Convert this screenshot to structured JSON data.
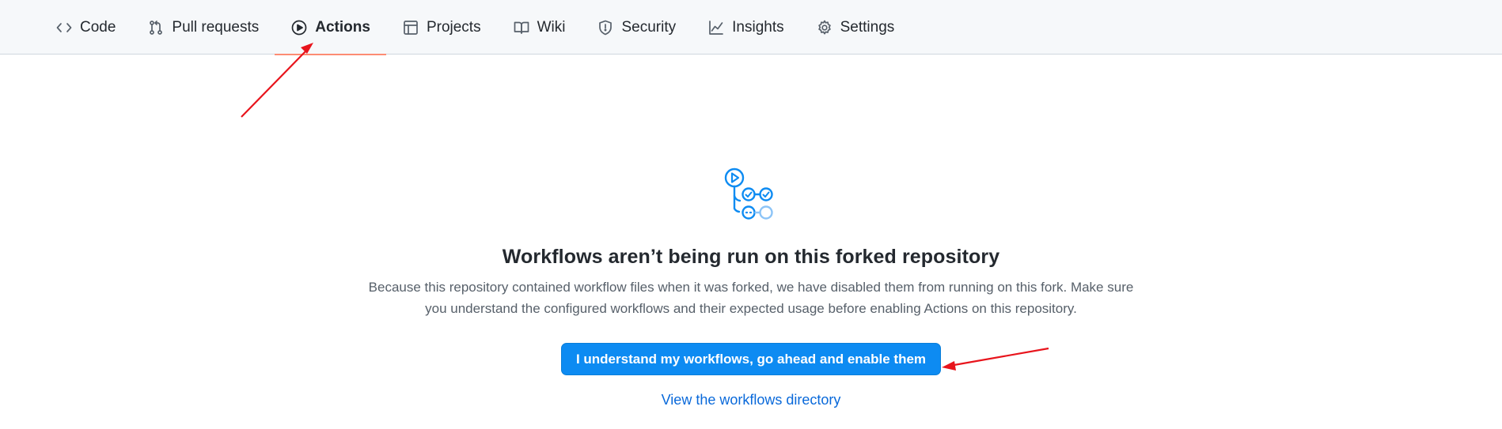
{
  "nav": {
    "tabs": [
      {
        "label": "Code",
        "icon": "code-icon",
        "selected": false
      },
      {
        "label": "Pull requests",
        "icon": "pull-request-icon",
        "selected": false
      },
      {
        "label": "Actions",
        "icon": "play-icon",
        "selected": true
      },
      {
        "label": "Projects",
        "icon": "table-icon",
        "selected": false
      },
      {
        "label": "Wiki",
        "icon": "book-icon",
        "selected": false
      },
      {
        "label": "Security",
        "icon": "shield-icon",
        "selected": false
      },
      {
        "label": "Insights",
        "icon": "graph-icon",
        "selected": false
      },
      {
        "label": "Settings",
        "icon": "gear-icon",
        "selected": false
      }
    ],
    "selected_underline_color": "#fd8c73"
  },
  "blankslate": {
    "graphic_icon": "workflow-icon",
    "heading": "Workflows aren’t being run on this forked repository",
    "description_line1": "Because this repository contained workflow files when it was forked, we have disabled them from running on this fork. Make sure",
    "description_line2": "you understand the configured workflows and their expected usage before enabling Actions on this repository.",
    "enable_button_label": "I understand my workflows, go ahead and enable them",
    "view_link_label": "View the workflows directory"
  },
  "colors": {
    "primary_button": "#0d8bf2",
    "link": "#0969da",
    "annotation_arrow": "#e8141c"
  }
}
